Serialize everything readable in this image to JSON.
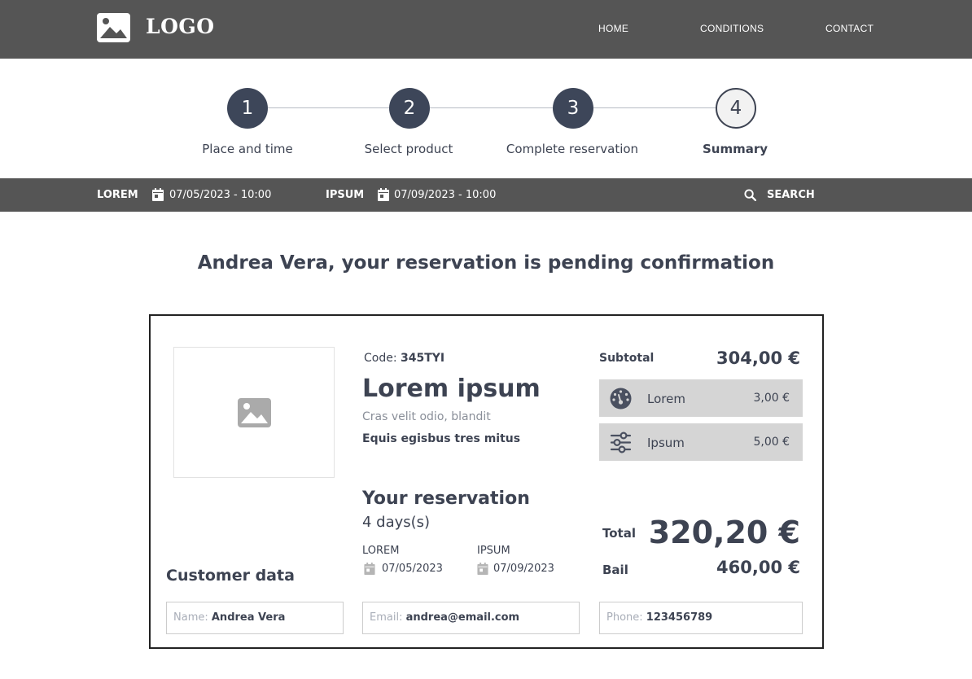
{
  "header": {
    "logo_text": "LOGO",
    "nav": [
      "HOME",
      "CONDITIONS",
      "CONTACT"
    ]
  },
  "stepper": {
    "current": 4,
    "steps": [
      {
        "number": "1",
        "label": "Place and time"
      },
      {
        "number": "2",
        "label": "Select product"
      },
      {
        "number": "3",
        "label": "Complete reservation"
      },
      {
        "number": "4",
        "label": "Summary"
      }
    ]
  },
  "search_bar": {
    "pickup_label": "LOREM",
    "pickup_value": "07/05/2023 - 10:00",
    "return_label": "IPSUM",
    "return_value": "07/09/2023 - 10:00",
    "search_label": "SEARCH"
  },
  "page_title": "Andrea Vera, your reservation is pending confirmation",
  "product": {
    "code_label": "Code:",
    "code_value": "345TYI",
    "name": "Lorem ipsum",
    "subtitle": "Cras velit odio,  blandit",
    "description": "Equis egisbus tres mitus"
  },
  "reservation": {
    "title": "Your reservation",
    "duration": "4 days(s)",
    "start_label": "LOREM",
    "start_date": "07/05/2023",
    "end_label": "IPSUM",
    "end_date": "07/09/2023"
  },
  "pricing": {
    "subtotal_label": "Subtotal",
    "subtotal_value": "304,00 €",
    "extras": [
      {
        "label": "Lorem",
        "value": "3,00 €",
        "icon": "gauge-icon"
      },
      {
        "label": "Ipsum",
        "value": "5,00 €",
        "icon": "sliders-icon"
      }
    ],
    "total_label": "Total",
    "total_value": "320,20 €",
    "bail_label": "Bail",
    "bail_value": "460,00 €"
  },
  "customer": {
    "title": "Customer data",
    "name_placeholder": "Name:",
    "name_value": "Andrea Vera",
    "email_placeholder": "Email:",
    "email_value": "andrea@email.com",
    "phone_placeholder": "Phone:",
    "phone_value": "123456789"
  },
  "colors": {
    "header_bg": "#555555",
    "step_fill": "#3d4659",
    "text": "#3d4352",
    "extra_bg": "#d5d5d5"
  }
}
